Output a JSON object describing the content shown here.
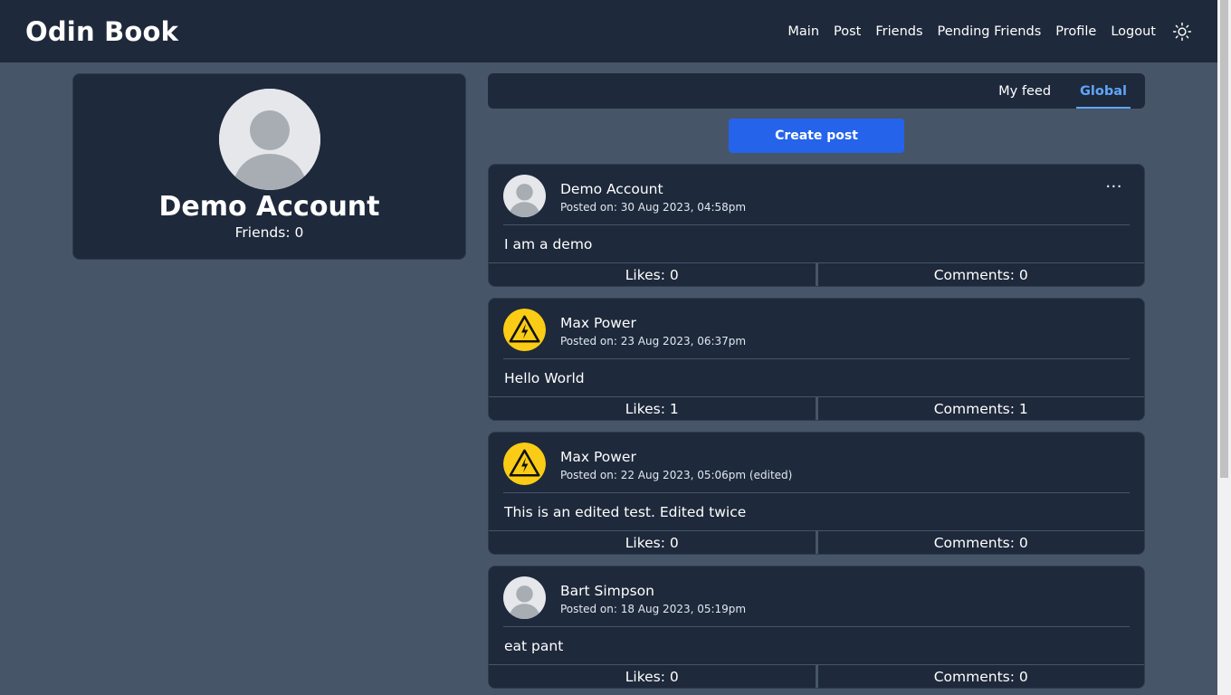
{
  "header": {
    "brand": "Odin Book",
    "nav": [
      "Main",
      "Post",
      "Friends",
      "Pending Friends",
      "Profile",
      "Logout"
    ],
    "theme_icon": "sun-icon"
  },
  "profile": {
    "name": "Demo Account",
    "friends": "Friends: 0",
    "avatar_icon": "default-avatar-icon"
  },
  "feed": {
    "tabs": [
      "My feed",
      "Global"
    ],
    "active_tab": "Global",
    "create_post_label": "Create post"
  },
  "posts": [
    {
      "author": "Demo Account",
      "date": "Posted on: 30 Aug 2023, 04:58pm",
      "body": "I am a demo",
      "likes": "Likes: 0",
      "comments": "Comments: 0",
      "avatar": "default-avatar-icon",
      "menu": "···"
    },
    {
      "author": "Max Power",
      "date": "Posted on: 23 Aug 2023, 06:37pm",
      "body": "Hello World",
      "likes": "Likes: 1",
      "comments": "Comments: 1",
      "avatar": "high-voltage-warning-icon"
    },
    {
      "author": "Max Power",
      "date": "Posted on: 22 Aug 2023, 05:06pm (edited)",
      "body": "This is an edited test. Edited twice",
      "likes": "Likes: 0",
      "comments": "Comments: 0",
      "avatar": "high-voltage-warning-icon"
    },
    {
      "author": "Bart Simpson",
      "date": "Posted on: 18 Aug 2023, 05:19pm",
      "body": "eat pant",
      "likes": "Likes: 0",
      "comments": "Comments: 0",
      "avatar": "default-avatar-icon"
    }
  ],
  "colors": {
    "page_bg": "#475569",
    "card_bg": "#1e293b",
    "accent": "#60a5fa",
    "button": "#2563eb",
    "warning_yellow": "#facc15"
  }
}
